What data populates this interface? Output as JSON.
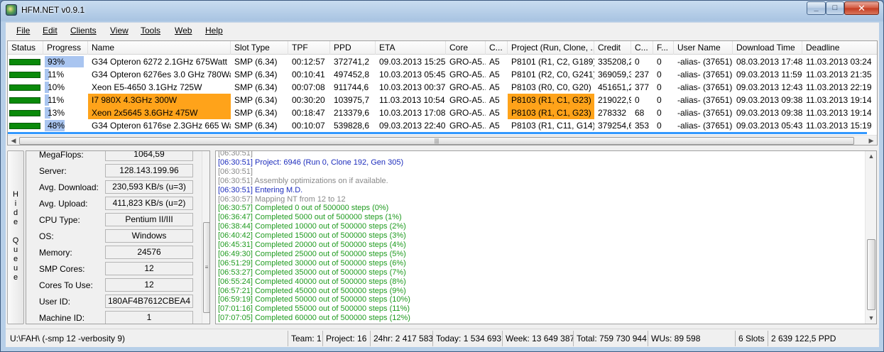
{
  "window": {
    "title": "HFM.NET v0.9.1",
    "min": "_",
    "max": "□",
    "close": "✕"
  },
  "menu": [
    {
      "label": "File"
    },
    {
      "label": "Edit"
    },
    {
      "label": "Clients"
    },
    {
      "label": "View"
    },
    {
      "label": "Tools"
    },
    {
      "label": "Web"
    },
    {
      "label": "Help"
    }
  ],
  "grid": {
    "columns": [
      "Status",
      "Progress",
      "Name",
      "Slot Type",
      "TPF",
      "PPD",
      "ETA",
      "Core",
      "C...",
      "Project (Run, Clone, ...",
      "Credit",
      "C...",
      "F...",
      "User Name",
      "Download Time",
      "Deadline"
    ],
    "rows": [
      {
        "progress": "93%",
        "pct": 93,
        "name": "G34 Opteron 6272 2.1GHz 675Watt",
        "slot": "SMP (6.34)",
        "tpf": "00:12:57",
        "ppd": "372741,2",
        "eta": "09.03.2013 15:25",
        "core": "GRO-A5...",
        "c": "A5",
        "project": "P8101 (R1, C2, G189)",
        "credit": "335208,2",
        "c2": "0",
        "f": "0",
        "user": "-alias- (37651)",
        "download": "08.03.2013 17:48",
        "deadline": "11.03.2013 03:24",
        "hl_name": false,
        "hl_project": false
      },
      {
        "progress": "11%",
        "pct": 11,
        "name": "G34 Opteron 6276es 3.0 GHz 780Watt",
        "slot": "SMP (6.34)",
        "tpf": "00:10:41",
        "ppd": "497452,8",
        "eta": "10.03.2013 05:45",
        "core": "GRO-A5...",
        "c": "A5",
        "project": "P8101 (R2, C0, G241)",
        "credit": "369059,3",
        "c2": "237",
        "f": "0",
        "user": "-alias- (37651)",
        "download": "09.03.2013 11:59",
        "deadline": "11.03.2013 21:35",
        "hl_name": false,
        "hl_project": false
      },
      {
        "progress": "10%",
        "pct": 10,
        "name": "Xeon E5-4650 3.1GHz 725W",
        "slot": "SMP (6.34)",
        "tpf": "00:07:08",
        "ppd": "911744,6",
        "eta": "10.03.2013 00:37",
        "core": "GRO-A5...",
        "c": "A5",
        "project": "P8103 (R0, C0, G20)",
        "credit": "451651,2",
        "c2": "377",
        "f": "0",
        "user": "-alias- (37651)",
        "download": "09.03.2013 12:43",
        "deadline": "11.03.2013 22:19",
        "hl_name": false,
        "hl_project": false
      },
      {
        "progress": "11%",
        "pct": 11,
        "name": "I7 980X 4.3GHz 300W",
        "slot": "SMP (6.34)",
        "tpf": "00:30:20",
        "ppd": "103975,7",
        "eta": "11.03.2013 10:54",
        "core": "GRO-A5...",
        "c": "A5",
        "project": "P8103 (R1, C1, G23)",
        "credit": "219022,9",
        "c2": "0",
        "f": "0",
        "user": "-alias- (37651)",
        "download": "09.03.2013 09:38",
        "deadline": "11.03.2013 19:14",
        "hl_name": true,
        "hl_project": true
      },
      {
        "progress": "13%",
        "pct": 13,
        "name": "Xeon 2x5645 3.6GHz 475W",
        "slot": "SMP (6.34)",
        "tpf": "00:18:47",
        "ppd": "213379,6",
        "eta": "10.03.2013 17:08",
        "core": "GRO-A5...",
        "c": "A5",
        "project": "P8103 (R1, C1, G23)",
        "credit": "278332",
        "c2": "68",
        "f": "0",
        "user": "-alias- (37651)",
        "download": "09.03.2013 09:38",
        "deadline": "11.03.2013 19:14",
        "hl_name": true,
        "hl_project": true
      },
      {
        "progress": "48%",
        "pct": 48,
        "name": "G34 Opteron 6176se 2.3GHz 665 Watt",
        "slot": "SMP (6.34)",
        "tpf": "00:10:07",
        "ppd": "539828,6",
        "eta": "09.03.2013 22:40",
        "core": "GRO-A5...",
        "c": "A5",
        "project": "P8103 (R1, C11, G14)",
        "credit": "379254,6",
        "c2": "353",
        "f": "0",
        "user": "-alias- (37651)",
        "download": "09.03.2013 05:43",
        "deadline": "11.03.2013 15:19",
        "hl_name": false,
        "hl_project": false
      }
    ]
  },
  "hide_queue": {
    "label": "Hide Queue"
  },
  "queue": [
    {
      "label": "MegaFlops:",
      "value": "1064,59"
    },
    {
      "label": "Server:",
      "value": "128.143.199.96"
    },
    {
      "label": "Avg. Download:",
      "value": "230,593 KB/s (u=3)"
    },
    {
      "label": "Avg. Upload:",
      "value": "411,823 KB/s (u=2)"
    },
    {
      "label": "CPU Type:",
      "value": "Pentium II/III"
    },
    {
      "label": "OS:",
      "value": "Windows"
    },
    {
      "label": "Memory:",
      "value": "24576"
    },
    {
      "label": "SMP Cores:",
      "value": "12"
    },
    {
      "label": "Cores To Use:",
      "value": "12"
    },
    {
      "label": "User ID:",
      "value": "180AF4B7612CBEA4"
    },
    {
      "label": "Machine ID:",
      "value": "1"
    }
  ],
  "log": [
    {
      "text": "[06:30:51]",
      "color": "gray"
    },
    {
      "text": "[06:30:51] Project: 6946 (Run 0, Clone 192, Gen 305)",
      "color": "blue"
    },
    {
      "text": "[06:30:51]",
      "color": "gray"
    },
    {
      "text": "[06:30:51] Assembly optimizations on if available.",
      "color": "gray"
    },
    {
      "text": "[06:30:51] Entering M.D.",
      "color": "blue"
    },
    {
      "text": "[06:30:57] Mapping NT from 12 to 12",
      "color": "gray"
    },
    {
      "text": "[06:30:57] Completed 0 out of 500000 steps  (0%)",
      "color": "green"
    },
    {
      "text": "[06:36:47] Completed 5000 out of 500000 steps  (1%)",
      "color": "green"
    },
    {
      "text": "[06:38:44] Completed 10000 out of 500000 steps  (2%)",
      "color": "green"
    },
    {
      "text": "[06:40:42] Completed 15000 out of 500000 steps  (3%)",
      "color": "green"
    },
    {
      "text": "[06:45:31] Completed 20000 out of 500000 steps  (4%)",
      "color": "green"
    },
    {
      "text": "[06:49:30] Completed 25000 out of 500000 steps  (5%)",
      "color": "green"
    },
    {
      "text": "[06:51:29] Completed 30000 out of 500000 steps  (6%)",
      "color": "green"
    },
    {
      "text": "[06:53:27] Completed 35000 out of 500000 steps  (7%)",
      "color": "green"
    },
    {
      "text": "[06:55:24] Completed 40000 out of 500000 steps  (8%)",
      "color": "green"
    },
    {
      "text": "[06:57:21] Completed 45000 out of 500000 steps  (9%)",
      "color": "green"
    },
    {
      "text": "[06:59:19] Completed 50000 out of 500000 steps  (10%)",
      "color": "green"
    },
    {
      "text": "[07:01:16] Completed 55000 out of 500000 steps  (11%)",
      "color": "green"
    },
    {
      "text": "[07:07:05] Completed 60000 out of 500000 steps  (12%)",
      "color": "green"
    }
  ],
  "statusbar": {
    "path": "U:\\FAH\\ (-smp 12 -verbosity 9)",
    "team": "Team: 1",
    "project": "Project: 16",
    "h24": "24hr: 2 417 583",
    "today": "Today: 1 534 693",
    "week": "Week: 13 649 387",
    "total": "Total: 759 730 944",
    "wus": "WUs: 89 598",
    "slots": "6 Slots",
    "ppd": "2 639 122,5 PPD"
  },
  "colors": {
    "highlight": "#ffa31a",
    "status_ok": "#0a8a0a",
    "log_blue": "#1d2dbd",
    "log_green": "#1f9b1f",
    "log_gray": "#8a8a8a"
  }
}
